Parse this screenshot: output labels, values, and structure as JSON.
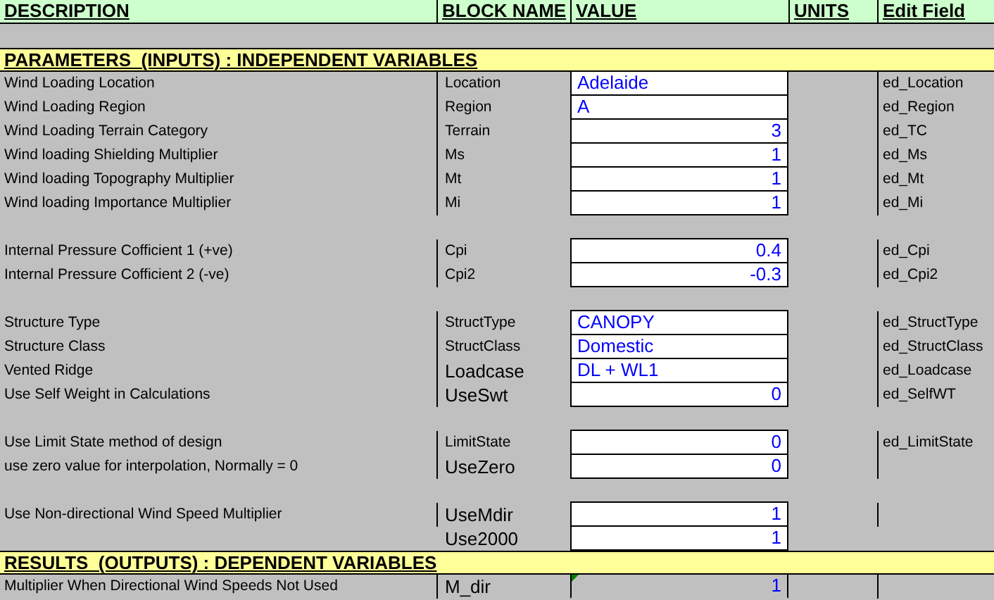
{
  "columns": [
    "DESCRIPTION",
    "BLOCK NAME",
    "VALUE",
    "UNITS",
    "Edit Field"
  ],
  "rows": [
    {
      "kind": "blank"
    },
    {
      "kind": "section",
      "title": "PARAMETERS  (INPUTS) : INDEPENDENT VARIABLES"
    },
    {
      "kind": "param",
      "description": "Wind Loading Location",
      "block": "Location",
      "value": "Adelaide",
      "numeric": false,
      "input": true,
      "bordered": true,
      "large": false,
      "edit": "ed_Location"
    },
    {
      "kind": "param",
      "description": "Wind Loading Region",
      "block": "Region",
      "value": "A",
      "numeric": false,
      "input": true,
      "bordered": true,
      "large": false,
      "edit": "ed_Region"
    },
    {
      "kind": "param",
      "description": "Wind Loading Terrain Category",
      "block": "Terrain",
      "value": "3",
      "numeric": true,
      "input": true,
      "bordered": true,
      "large": false,
      "edit": "ed_TC"
    },
    {
      "kind": "param",
      "description": "Wind loading Shielding Multiplier",
      "block": "Ms",
      "value": "1",
      "numeric": true,
      "input": true,
      "bordered": true,
      "large": false,
      "edit": "ed_Ms"
    },
    {
      "kind": "param",
      "description": "Wind loading Topography Multiplier",
      "block": "Mt",
      "value": "1",
      "numeric": true,
      "input": true,
      "bordered": true,
      "large": false,
      "edit": "ed_Mt"
    },
    {
      "kind": "param",
      "description": "Wind loading Importance Multiplier",
      "block": "Mi",
      "value": "1",
      "numeric": true,
      "input": true,
      "bordered": true,
      "large": false,
      "edit": "ed_Mi"
    },
    {
      "kind": "blank"
    },
    {
      "kind": "param",
      "description": "Internal Pressure Cofficient 1 (+ve)",
      "block": "Cpi",
      "value": "0.4",
      "numeric": true,
      "input": true,
      "bordered": true,
      "large": false,
      "edit": "ed_Cpi"
    },
    {
      "kind": "param",
      "description": "Internal Pressure Cofficient 2 (-ve)",
      "block": "Cpi2",
      "value": "-0.3",
      "numeric": true,
      "input": true,
      "bordered": true,
      "large": false,
      "edit": "ed_Cpi2"
    },
    {
      "kind": "blank"
    },
    {
      "kind": "param",
      "description": "Structure Type",
      "block": "StructType",
      "value": "CANOPY",
      "numeric": false,
      "input": true,
      "bordered": true,
      "large": false,
      "edit": "ed_StructType"
    },
    {
      "kind": "param",
      "description": "Structure Class",
      "block": "StructClass",
      "value": "Domestic",
      "numeric": false,
      "input": true,
      "bordered": true,
      "large": false,
      "edit": "ed_StructClass"
    },
    {
      "kind": "param",
      "description": "Vented Ridge",
      "block": "Loadcase",
      "value": "DL + WL1",
      "numeric": false,
      "input": true,
      "bordered": true,
      "large": true,
      "edit": "ed_Loadcase"
    },
    {
      "kind": "param",
      "description": "Use Self Weight in Calculations",
      "block": "UseSwt",
      "value": "0",
      "numeric": true,
      "input": true,
      "bordered": true,
      "large": true,
      "edit": "ed_SelfWT"
    },
    {
      "kind": "blank"
    },
    {
      "kind": "param",
      "description": "Use Limit State method of design",
      "block": "LimitState",
      "value": "0",
      "numeric": true,
      "input": true,
      "bordered": true,
      "large": false,
      "edit": "ed_LimitState"
    },
    {
      "kind": "param",
      "description": "use zero value for interpolation, Normally = 0",
      "block": "UseZero",
      "value": "0",
      "numeric": true,
      "input": true,
      "bordered": true,
      "large": true
    },
    {
      "kind": "blank"
    },
    {
      "kind": "param",
      "description": "Use Non-directional Wind Speed Multiplier",
      "block": "UseMdir",
      "value": "1",
      "numeric": true,
      "input": true,
      "bordered": true,
      "large": true
    },
    {
      "kind": "param",
      "block": "Use2000",
      "value": "1",
      "numeric": true,
      "input": true,
      "bordered": false,
      "large": true
    },
    {
      "kind": "section",
      "title": "RESULTS  (OUTPUTS) : DEPENDENT VARIABLES"
    },
    {
      "kind": "param",
      "description": "Multiplier When Directional Wind Speeds Not Used",
      "block": "M_dir",
      "value": "1",
      "numeric": true,
      "input": false,
      "note": true,
      "bordered": true,
      "large": true
    }
  ]
}
